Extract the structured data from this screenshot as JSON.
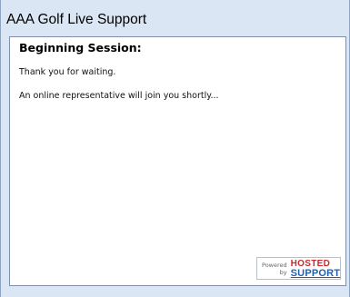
{
  "window": {
    "title": "AAA Golf Live Support"
  },
  "session": {
    "heading": "Beginning Session:",
    "messages": [
      "Thank you for waiting.",
      "An online representative will join you shortly..."
    ]
  },
  "badge": {
    "powered": "Powered",
    "by": "by",
    "logo_line1": "HOSTED",
    "logo_line2": "SUPPORT"
  },
  "colors": {
    "frame": "#dbe6f4",
    "logo_red": "#c72b2b",
    "logo_blue": "#1f5fb0"
  }
}
